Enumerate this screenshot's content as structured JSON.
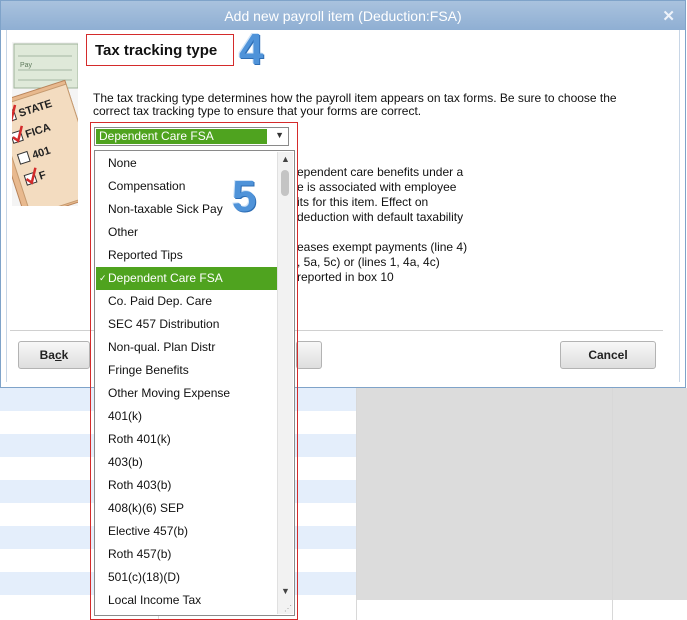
{
  "dialog": {
    "title": "Add new payroll item (Deduction:FSA)",
    "close_glyph": "✕"
  },
  "section": {
    "heading": "Tax tracking type",
    "description": "The tax tracking type determines how the payroll item appears on tax forms.  Be sure to choose the correct tax tracking type to ensure that your forms are correct."
  },
  "annotations": {
    "step4": "4",
    "step5": "5"
  },
  "illustration": {
    "labels": [
      "STATE",
      "FICA",
      "401",
      "F"
    ],
    "pay_label": "Pay"
  },
  "select": {
    "value": "Dependent Care FSA",
    "arrow_glyph": "▼"
  },
  "dropdown": {
    "items": [
      "None",
      "Compensation",
      "Non-taxable Sick Pay",
      "Other",
      "Reported Tips",
      "Dependent Care FSA",
      "Co. Paid Dep. Care",
      "SEC 457 Distribution",
      "Non-qual. Plan Distr",
      "Fringe Benefits",
      "Other Moving Expense",
      "401(k)",
      "Roth 401(k)",
      "403(b)",
      "Roth 403(b)",
      "408(k)(6) SEP",
      "Elective 457(b)",
      "Roth 457(b)",
      "501(c)(18)(D)",
      "Local Income Tax"
    ],
    "selected_index": 5,
    "check_glyph": "✓"
  },
  "partial_text": {
    "lines": [
      "ependent care benefits under a",
      "e is associated with employee",
      "its for this item.  Effect on",
      "deduction with default taxability",
      "",
      "eases exempt payments (line 4)",
      ", 5a, 5c) or (lines 1, 4a, 4c)",
      "reported in box 10"
    ]
  },
  "buttons": {
    "back": "Back",
    "cancel": "Cancel"
  },
  "colors": {
    "accent_green": "#4fa31f",
    "annotation_red": "#d42b2b",
    "annotation_blue": "#4f93d9",
    "titlebar_blue": "#9ab8da"
  }
}
